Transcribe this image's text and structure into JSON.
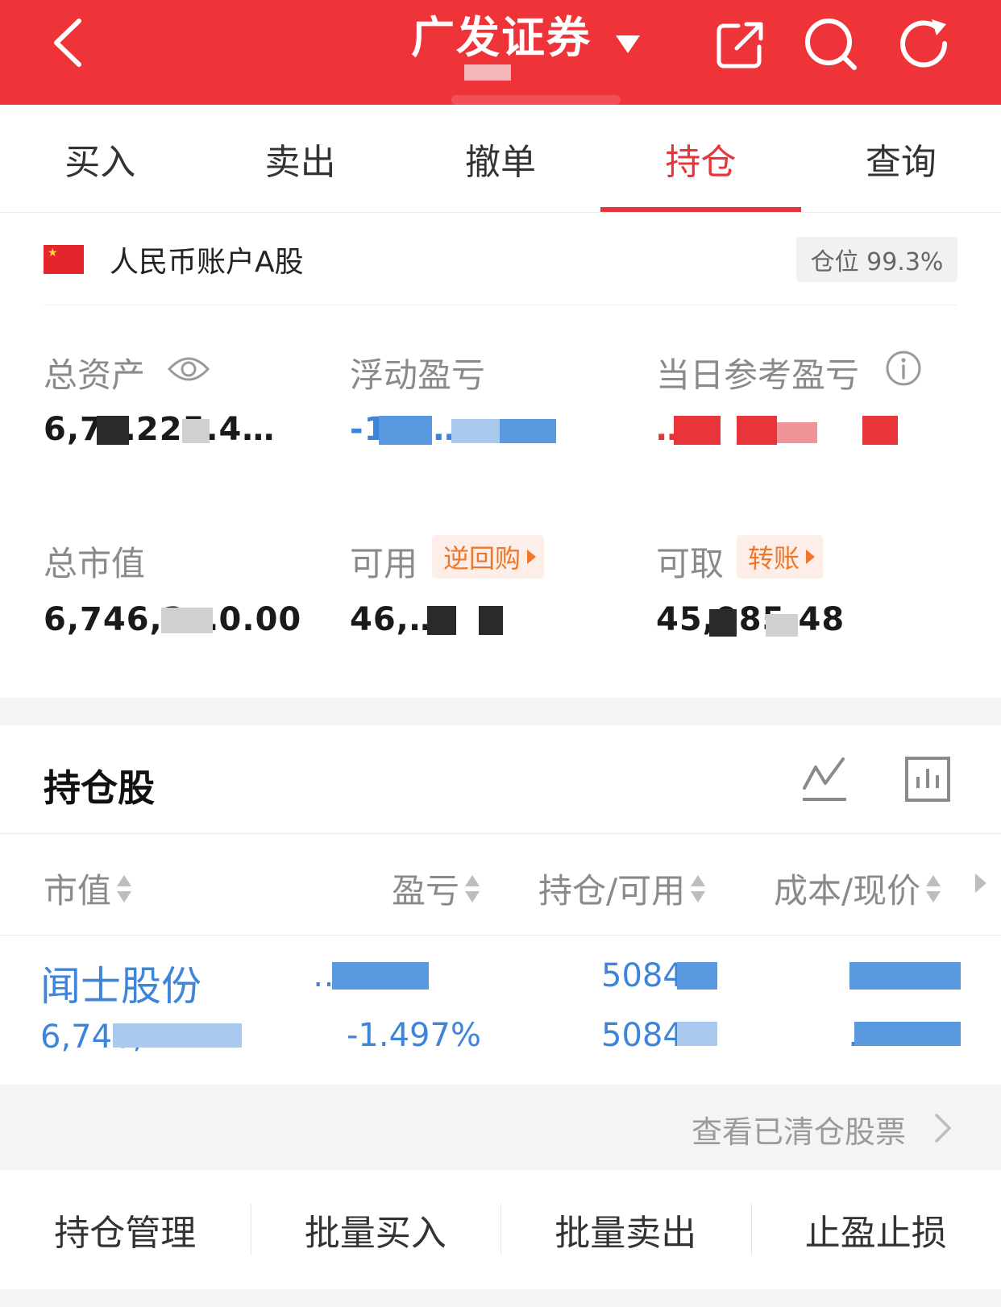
{
  "header": {
    "title": "广发证券",
    "bg_color": "#ee3339"
  },
  "icons": {
    "back": "chevron-left-icon",
    "title_dropdown": "caret-down-icon",
    "share": "share-icon",
    "search": "search-icon",
    "refresh": "refresh-icon",
    "eye": "eye-icon",
    "info": "info-icon",
    "trend": "trend-icon",
    "bar_chart": "bar-chart-icon"
  },
  "tabs": [
    {
      "label": "买入",
      "active": false
    },
    {
      "label": "卖出",
      "active": false
    },
    {
      "label": "撤单",
      "active": false
    },
    {
      "label": "持仓",
      "active": true
    },
    {
      "label": "查询",
      "active": false
    }
  ],
  "account": {
    "name": "人民币账户A股",
    "position_label": "仓位 99.3%"
  },
  "summary": {
    "total_assets": {
      "label": "总资产",
      "value": "6,7…225.4…"
    },
    "floating_pnl": {
      "label": "浮动盈亏",
      "value": "-1…,…"
    },
    "today_pnl": {
      "label": "当日参考盈亏",
      "value": "…"
    },
    "market_value": {
      "label": "总市值",
      "value": "6,746,2…0.00"
    },
    "available": {
      "label": "可用",
      "value": "46,…",
      "action": "逆回购"
    },
    "withdrawable": {
      "label": "可取",
      "value": "45,985.48",
      "action": "转账"
    }
  },
  "holdings": {
    "title": "持仓股",
    "columns": [
      "市值",
      "盈亏",
      "持仓/可用",
      "成本/现价"
    ],
    "rows": [
      {
        "name": "闻士股份",
        "market_value": "6,746,…",
        "pnl": "…48",
        "pnl_pct": "-1.497%",
        "position": "5084…",
        "available": "5084…",
        "cost": "…",
        "price": "…"
      }
    ],
    "cleared_link": "查看已清仓股票"
  },
  "bottom_actions": [
    "持仓管理",
    "批量买入",
    "批量卖出",
    "止盈止损"
  ],
  "colors": {
    "accent_red": "#e9343a",
    "link_blue": "#3d84db",
    "orange": "#f07628"
  }
}
